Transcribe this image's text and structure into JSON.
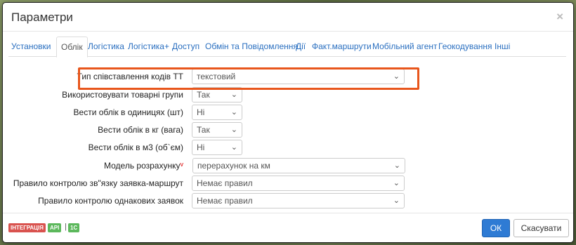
{
  "dialog": {
    "title": "Параметри",
    "close_glyph": "×"
  },
  "tabs": [
    {
      "label": "Установки"
    },
    {
      "label": "Облік"
    },
    {
      "label": "Логістика"
    },
    {
      "label": "Логістика+"
    },
    {
      "label": "Доступ"
    },
    {
      "label": "Обмін та Повідомлення"
    },
    {
      "label": "Дії"
    },
    {
      "label": "Факт.маршрути"
    },
    {
      "label": "Мобільний агент"
    },
    {
      "label": "Геокодування"
    },
    {
      "label": "Інші"
    }
  ],
  "active_tab": "Облік",
  "fields": [
    {
      "label": "Тип співставлення кодів ТТ",
      "value": "текстовий"
    },
    {
      "label": "Використовувати товарні групи",
      "value": "Так"
    },
    {
      "label": "Вести облік в одиницях (шт)",
      "value": "Ні"
    },
    {
      "label": "Вести облік в кг (вага)",
      "value": "Так"
    },
    {
      "label": "Вести облік в м3 (об`єм)",
      "value": "Ні"
    },
    {
      "label": "Модель розрахунку",
      "required_mark": "v",
      "value": "перерахунок на км"
    },
    {
      "label": "Правило контролю зв\"язку заявка-маршрут",
      "value": "Немає правил"
    },
    {
      "label": "Правило контролю однакових заявок",
      "value": "Немає правил"
    }
  ],
  "footer": {
    "badges": [
      {
        "label": "ІНТЕГРАЦІЯ",
        "color": "#d9534f"
      },
      {
        "label": "API",
        "color": "#5cb85c"
      },
      {
        "label": "1С",
        "color": "#5cb85c"
      }
    ],
    "separator": "|",
    "ok_label": "ОК",
    "cancel_label": "Скасувати"
  },
  "colors": {
    "accent": "#2e7bd4",
    "highlight": "#e8561c",
    "link": "#2a6fc0"
  },
  "icons": {
    "select_arrow": "chevron-down-icon"
  }
}
